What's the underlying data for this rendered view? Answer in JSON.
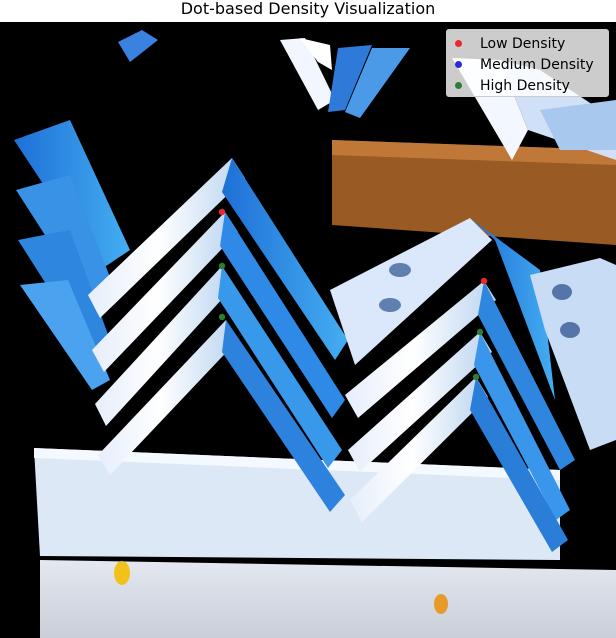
{
  "chart_data": {
    "type": "scatter",
    "title": "Dot-based Density Visualization",
    "xlabel": "",
    "ylabel": "",
    "background": "photo of stacked blue-tinted metal angle brackets on a concrete floor",
    "grid": false,
    "legend_position": "top-right",
    "series": [
      {
        "name": "Low Density",
        "color": "#e8282d",
        "points": [
          {
            "x": 222,
            "y": 212
          },
          {
            "x": 484,
            "y": 281
          }
        ]
      },
      {
        "name": "Medium Density",
        "color": "#2a2adb",
        "points": []
      },
      {
        "name": "High Density",
        "color": "#2e7d32",
        "points": [
          {
            "x": 222,
            "y": 266
          },
          {
            "x": 222,
            "y": 317
          },
          {
            "x": 480,
            "y": 332
          },
          {
            "x": 476,
            "y": 377
          }
        ]
      }
    ]
  }
}
